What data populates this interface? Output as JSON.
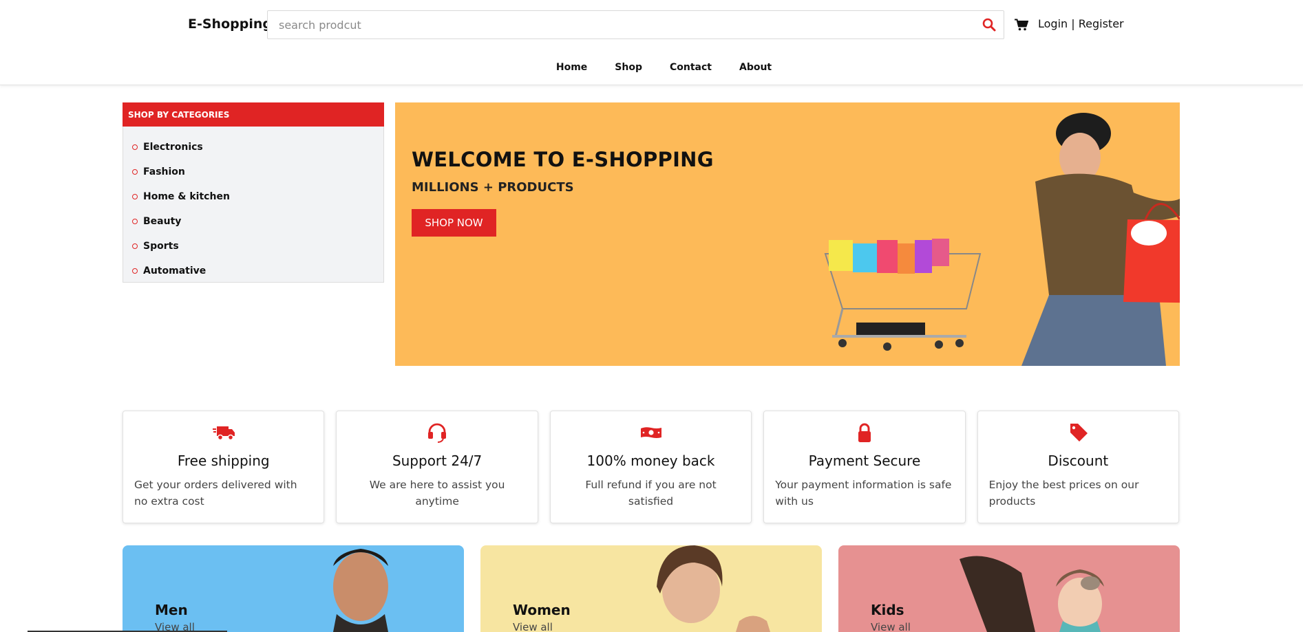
{
  "header": {
    "logo": "E-Shopping",
    "search_placeholder": "search prodcut",
    "search_icon": "search-icon",
    "cart_icon": "cart-icon",
    "login": "Login",
    "separator": " | ",
    "register": "Register",
    "nav": [
      "Home",
      "Shop",
      "Contact",
      "About"
    ]
  },
  "sidebar": {
    "title": "SHOP BY CATEGORIES",
    "items": [
      "Electronics",
      "Fashion",
      "Home & kitchen",
      "Beauty",
      "Sports",
      "Automative"
    ]
  },
  "hero": {
    "title": "WELCOME TO E-SHOPPING",
    "subtitle": "MILLIONS + PRODUCTS",
    "button": "SHOP NOW",
    "background": "#fdba58"
  },
  "features": [
    {
      "icon": "truck-icon",
      "title": "Free shipping",
      "text": "Get your orders delivered with no extra cost"
    },
    {
      "icon": "headset-icon",
      "title": "Support 24/7",
      "text": "We are here to assist you anytime"
    },
    {
      "icon": "money-icon",
      "title": "100% money back",
      "text": "Full refund if you are not satisfied"
    },
    {
      "icon": "lock-icon",
      "title": "Payment Secure",
      "text": "Your payment information is safe with us"
    },
    {
      "icon": "tag-icon",
      "title": "Discount",
      "text": "Enjoy the best prices on our products"
    }
  ],
  "tiles": [
    {
      "title": "Men",
      "link": "View all",
      "color": "#6bbff2"
    },
    {
      "title": "Women",
      "link": "View all",
      "color": "#f7e5a1"
    },
    {
      "title": "Kids",
      "link": "View all",
      "color": "#e69191"
    }
  ],
  "colors": {
    "accent": "#e02424",
    "sidebar_bg": "#f2f3f5"
  }
}
